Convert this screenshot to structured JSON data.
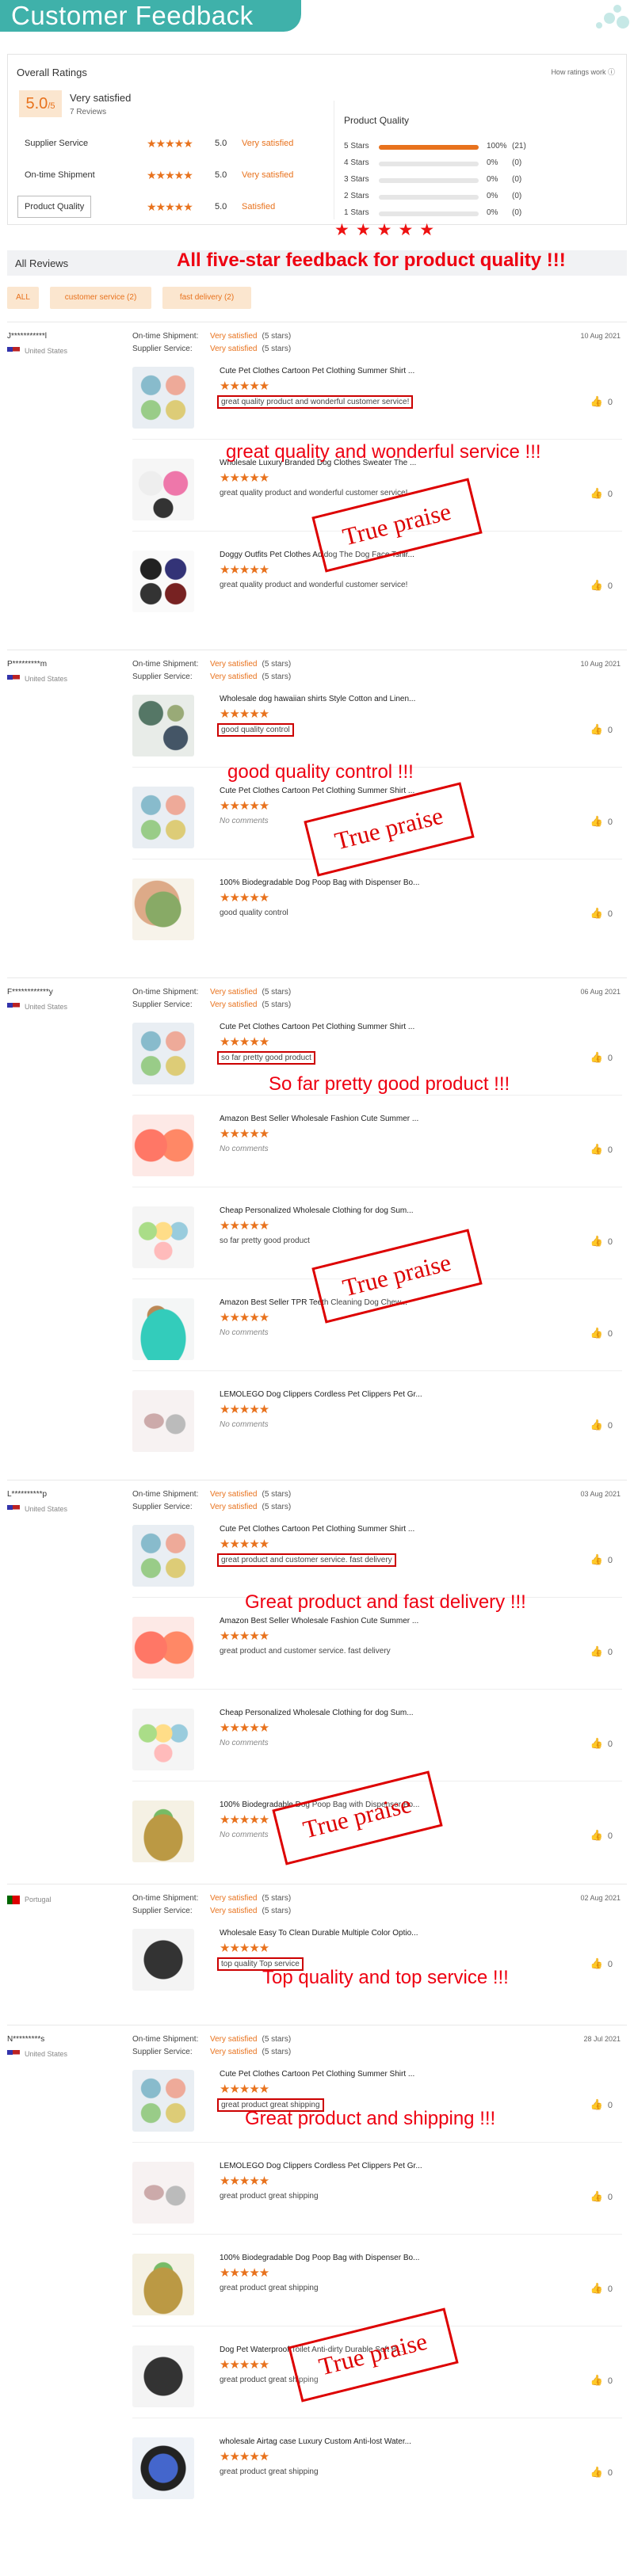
{
  "header": {
    "title": "Customer Feedback"
  },
  "overall": {
    "title": "Overall Ratings",
    "how_link": "How ratings work",
    "score": "5.0",
    "score_suffix": "/5",
    "satisfaction": "Very satisfied",
    "review_count": "7 Reviews",
    "categories": [
      {
        "label": "Supplier Service",
        "stars": "★★★★★",
        "value": "5.0",
        "text": "Very satisfied"
      },
      {
        "label": "On-time Shipment",
        "stars": "★★★★★",
        "value": "5.0",
        "text": "Very satisfied"
      },
      {
        "label": "Product Quality",
        "stars": "★★★★★",
        "value": "5.0",
        "text": "Satisfied"
      }
    ]
  },
  "product_quality": {
    "title": "Product Quality",
    "rows": [
      {
        "label": "5 Stars",
        "percent": "100%",
        "count": "(21)",
        "fraction": 1.0
      },
      {
        "label": "4 Stars",
        "percent": "0%",
        "count": "(0)",
        "fraction": 0
      },
      {
        "label": "3 Stars",
        "percent": "0%",
        "count": "(0)",
        "fraction": 0
      },
      {
        "label": "2 Stars",
        "percent": "0%",
        "count": "(0)",
        "fraction": 0
      },
      {
        "label": "1 Stars",
        "percent": "0%",
        "count": "(0)",
        "fraction": 0
      }
    ],
    "big_stars": "★★★★★"
  },
  "all_reviews": {
    "title": "All Reviews",
    "annotation": "All five-star feedback for product quality !!!",
    "filters": [
      "ALL",
      "customer service (2)",
      "fast delivery (2)"
    ]
  },
  "labels": {
    "shipment": "On-time Shipment:",
    "supplier": "Supplier Service:",
    "very_satisfied": "Very satisfied",
    "five_stars": "(5 stars)",
    "like_icon": "thumbs-up-icon",
    "stamp": "True praise",
    "stars": "★★★★★"
  },
  "reviews": [
    {
      "user": "J***********l",
      "country": "United States",
      "date": "10 Aug 2021",
      "annotation": "great quality and wonderful service !!!",
      "products": [
        {
          "name": "Cute Pet Clothes Cartoon Pet Clothing Summer Shirt ...",
          "text": "great quality product and wonderful customer service!",
          "likes": "0"
        },
        {
          "name": "Wholesale Luxury Branded Dog Clothes Sweater The ...",
          "text": "great quality product and wonderful customer service!",
          "likes": "0"
        },
        {
          "name": "Doggy Outfits Pet Clothes Adidog The Dog Face Tshir...",
          "text": "great quality product and wonderful customer service!",
          "likes": "0"
        }
      ]
    },
    {
      "user": "P*********m",
      "country": "United States",
      "date": "10 Aug 2021",
      "annotation": "good quality control !!!",
      "products": [
        {
          "name": "Wholesale dog hawaiian shirts Style Cotton and Linen...",
          "text": "good quality control",
          "likes": "0"
        },
        {
          "name": "Cute Pet Clothes Cartoon Pet Clothing Summer Shirt ...",
          "text": "No comments",
          "likes": "0"
        },
        {
          "name": "100% Biodegradable Dog Poop Bag with Dispenser Bo...",
          "text": "good quality control",
          "likes": "0"
        }
      ]
    },
    {
      "user": "F************y",
      "country": "United States",
      "date": "06 Aug 2021",
      "annotation": "So far pretty good product !!!",
      "products": [
        {
          "name": "Cute Pet Clothes Cartoon Pet Clothing Summer Shirt ...",
          "text": "so far pretty good product",
          "likes": "0"
        },
        {
          "name": "Amazon Best Seller Wholesale Fashion Cute Summer ...",
          "text": "No comments",
          "likes": "0"
        },
        {
          "name": "Cheap Personalized Wholesale Clothing for dog Sum...",
          "text": "so far pretty good product",
          "likes": "0"
        },
        {
          "name": "Amazon Best Seller TPR Teeth Cleaning Dog Chew...",
          "text": "No comments",
          "likes": "0"
        },
        {
          "name": "LEMOLEGO Dog Clippers Cordless Pet Clippers Pet Gr...",
          "text": "No comments",
          "likes": "0"
        }
      ]
    },
    {
      "user": "L**********p",
      "country": "United States",
      "date": "03 Aug 2021",
      "annotation": "Great product and fast delivery !!!",
      "products": [
        {
          "name": "Cute Pet Clothes Cartoon Pet Clothing Summer Shirt ...",
          "text": "great product and customer service. fast delivery",
          "likes": "0"
        },
        {
          "name": "Amazon Best Seller Wholesale Fashion Cute Summer ...",
          "text": "great product and customer service. fast delivery",
          "likes": "0"
        },
        {
          "name": "Cheap Personalized Wholesale Clothing for dog Sum...",
          "text": "No comments",
          "likes": "0"
        },
        {
          "name": "100% Biodegradable Dog Poop Bag with Dispenser Bo...",
          "text": "No comments",
          "likes": "0"
        }
      ]
    },
    {
      "user": "",
      "country": "Portugal",
      "date": "02 Aug 2021",
      "annotation": "Top quality and top service !!!",
      "products": [
        {
          "name": "Wholesale Easy To Clean Durable Multiple Color Optio...",
          "text": "top quality Top service",
          "likes": "0"
        }
      ]
    },
    {
      "user": "N*********s",
      "country": "United States",
      "date": "28 Jul 2021",
      "annotation": "Great product and shipping !!!",
      "products": [
        {
          "name": "Cute Pet Clothes Cartoon Pet Clothing Summer Shirt ...",
          "text": "great product great shipping",
          "likes": "0"
        },
        {
          "name": "LEMOLEGO Dog Clippers Cordless Pet Clippers Pet Gr...",
          "text": "great product great shipping",
          "likes": "0"
        },
        {
          "name": "100% Biodegradable Dog Poop Bag with Dispenser Bo...",
          "text": "great product great shipping",
          "likes": "0"
        },
        {
          "name": "Dog Pet Waterproof Toilet Anti-dirty Durable Soft B...",
          "text": "great product great shipping",
          "likes": "0"
        },
        {
          "name": "wholesale Airtag case Luxury Custom Anti-lost Water...",
          "text": "great product great shipping",
          "likes": "0"
        }
      ]
    }
  ]
}
